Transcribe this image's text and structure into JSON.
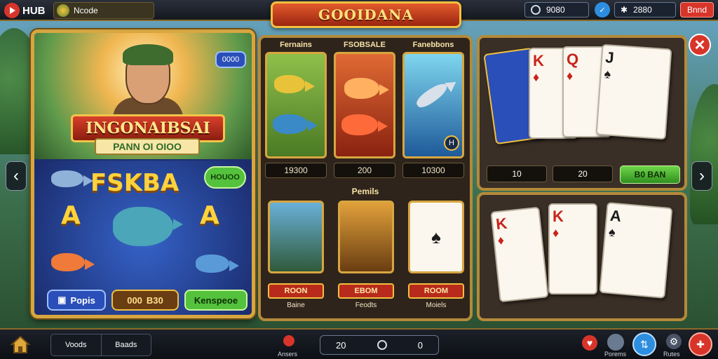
{
  "topbar": {
    "hub_label": "HUB",
    "mode_label": "Ncode",
    "title": "GOOIDANA",
    "pill_left": "9080",
    "pill_right": "2880",
    "cta": "Bnnd",
    "colors": {
      "accent": "#d8352a",
      "gold": "#d7a640",
      "twitter": "#2d8ee0"
    }
  },
  "left_panel": {
    "badge": "0000",
    "title": "INGONAIBSAI",
    "subtitle": "PANN OI OIOO",
    "reel_title": "FSKBA",
    "bet_chip": "HOUOO",
    "letters": [
      "A",
      "A"
    ],
    "buttons": [
      {
        "label": "Popis",
        "icon": "ticket-icon"
      },
      {
        "label": "000",
        "value": "B30"
      },
      {
        "label": "Kenspeoe"
      }
    ]
  },
  "slots": {
    "headers": [
      "Fernains",
      "FSOBSALE",
      "Fanebbons"
    ],
    "values": [
      "19300",
      "200",
      "10300"
    ],
    "badge": "H",
    "section_label": "Pemils",
    "minis": [
      {
        "ribbon": "ROON",
        "caption": "Baine"
      },
      {
        "ribbon": "EBOM",
        "caption": "Feodts"
      },
      {
        "ribbon": "ROOM",
        "caption": "Moiels"
      }
    ]
  },
  "cards_panel": {
    "values": [
      "10",
      "20"
    ],
    "button": "B0 BAN",
    "cards_top": [
      {
        "rank": "K",
        "suit": "♦",
        "color": "red"
      },
      {
        "rank": "Q",
        "suit": "♦",
        "color": "red"
      },
      {
        "rank": "J",
        "suit": "♠",
        "color": "black"
      }
    ],
    "cards_bottom": [
      {
        "rank": "K",
        "suit": "♦",
        "color": "red"
      },
      {
        "rank": "K",
        "suit": "♦",
        "color": "red"
      },
      {
        "rank": "A",
        "suit": "♠",
        "color": "black"
      }
    ]
  },
  "bottombar": {
    "box_left": "Voods",
    "box_right": "Baads",
    "center_cap": "Ansers",
    "score_left": "20",
    "score_right": "0",
    "icons": [
      {
        "name": "heart-icon",
        "cap": ""
      },
      {
        "name": "avatar-icon",
        "cap": "Porems"
      },
      {
        "name": "stats-icon",
        "cap": ""
      },
      {
        "name": "settings-icon",
        "cap": "Rutes"
      },
      {
        "name": "gift-icon",
        "cap": ""
      }
    ]
  }
}
